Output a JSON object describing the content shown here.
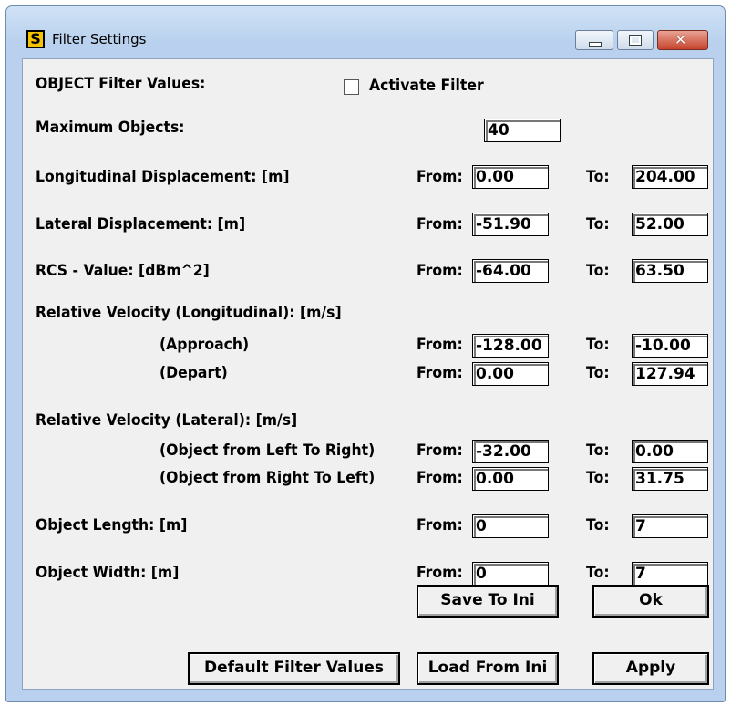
{
  "window": {
    "title": "Filter Settings",
    "icon_letter": "S"
  },
  "header": {
    "section_label": "OBJECT Filter Values:",
    "activate_filter_label": "Activate Filter",
    "activate_filter_checked": false
  },
  "max_objects": {
    "label": "Maximum Objects:",
    "value": "40"
  },
  "labels": {
    "from": "From:",
    "to": "To:"
  },
  "rows": {
    "longitudinal": {
      "label": "Longitudinal Displacement: [m]",
      "from": "0.00",
      "to": "204.00"
    },
    "lateral": {
      "label": "Lateral Displacement: [m]",
      "from": "-51.90",
      "to": "52.00"
    },
    "rcs": {
      "label": "RCS - Value: [dBm^2]",
      "from": "-64.00",
      "to": "63.50"
    },
    "rel_vel_long": {
      "label": "Relative Velocity (Longitudinal): [m/s]"
    },
    "approach": {
      "label": "(Approach)",
      "from": "-128.00",
      "to": "-10.00"
    },
    "depart": {
      "label": "(Depart)",
      "from": "0.00",
      "to": "127.94"
    },
    "rel_vel_lat": {
      "label": "Relative Velocity (Lateral): [m/s]"
    },
    "left_to_right": {
      "label": "(Object from Left To Right)",
      "from": "-32.00",
      "to": "0.00"
    },
    "right_to_left": {
      "label": "(Object from Right To Left)",
      "from": "0.00",
      "to": "31.75"
    },
    "length": {
      "label": "Object Length: [m]",
      "from": "0",
      "to": "7"
    },
    "width": {
      "label": "Object Width: [m]",
      "from": "0",
      "to": "7"
    }
  },
  "buttons": {
    "save_to_ini": "Save To Ini",
    "ok": "Ok",
    "default_values": "Default Filter Values",
    "load_from_ini": "Load From Ini",
    "apply": "Apply"
  }
}
